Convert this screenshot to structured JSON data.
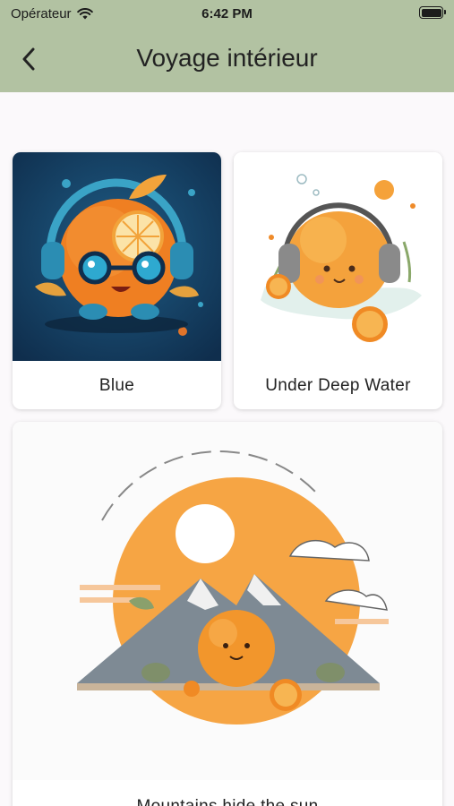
{
  "status_bar": {
    "carrier": "Opérateur",
    "time": "6:42 PM",
    "wifi_icon": "wifi-icon",
    "battery_icon": "battery-icon"
  },
  "header": {
    "title": "Voyage intérieur",
    "back_icon": "chevron-left-icon",
    "background": "#b2c2a2"
  },
  "cards": [
    {
      "label": "Blue",
      "image": "orange-with-headphones-blue-illustration"
    },
    {
      "label": "Under Deep Water",
      "image": "orange-with-headphones-in-water-illustration"
    },
    {
      "label": "Mountains hide the sun",
      "image": "orange-in-front-of-mountains-and-sun-illustration"
    }
  ]
}
